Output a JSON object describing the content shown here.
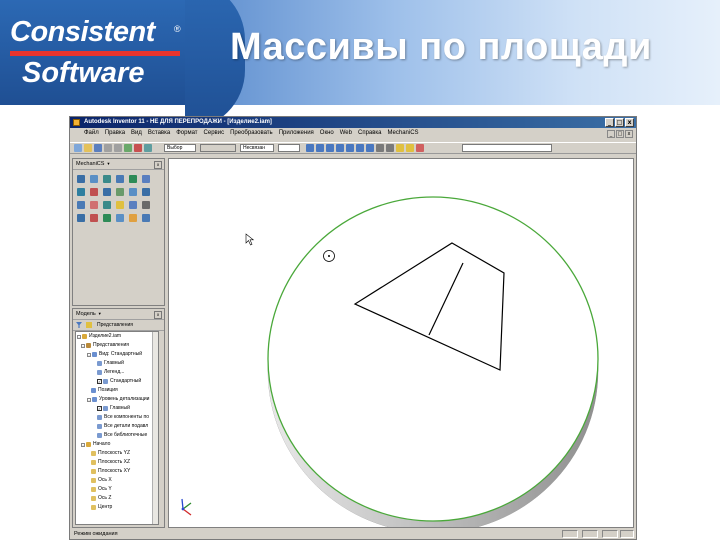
{
  "slide": {
    "title": "Массивы по площади",
    "logo": {
      "line1": "Consistent",
      "line2": "Software",
      "registered": "®"
    }
  },
  "window": {
    "title": "Autodesk Inventor 11 - НЕ ДЛЯ ПЕРЕПРОДАЖИ - [Изделие2.iam]",
    "controls": [
      "_",
      "□",
      "x"
    ]
  },
  "menu": {
    "items": [
      "Файл",
      "Правка",
      "Вид",
      "Вставка",
      "Формат",
      "Сервис",
      "Преобразовать",
      "Приложения",
      "Окно",
      "Web",
      "Справка",
      "MechaniCS"
    ],
    "mdi_controls": [
      "_",
      "□",
      "x"
    ]
  },
  "toolbar": {
    "select_label": "Выбор",
    "combo2": "",
    "combo3": "Несвязан",
    "combo4": "",
    "combo5": ""
  },
  "panel_top": {
    "title": "MechaniCS",
    "close": "x"
  },
  "panel_bottom": {
    "title": "Модель",
    "close": "x",
    "toolbar_label": "Представления",
    "tree": [
      {
        "label": "Изделие2.iam",
        "level": 0,
        "expander": "-"
      },
      {
        "label": "Представления",
        "level": 1,
        "expander": "-"
      },
      {
        "label": "Вид: Стандартный",
        "level": 2,
        "expander": "-"
      },
      {
        "label": "Главный",
        "level": 3
      },
      {
        "label": "Легенд...",
        "level": 3
      },
      {
        "label": "Стандартный",
        "level": 3,
        "checked": true
      },
      {
        "label": "Позиция",
        "level": 2
      },
      {
        "label": "Уровень детализации",
        "level": 2,
        "expander": "-"
      },
      {
        "label": "Главный",
        "level": 3,
        "checked": true
      },
      {
        "label": "Все компоненты по",
        "level": 3
      },
      {
        "label": "Все детали подавл",
        "level": 3
      },
      {
        "label": "Все библиотечные",
        "level": 3
      },
      {
        "label": "Начало",
        "level": 1,
        "expander": "-"
      },
      {
        "label": "Плоскость YZ",
        "level": 2
      },
      {
        "label": "Плоскость XZ",
        "level": 2
      },
      {
        "label": "Плоскость XY",
        "level": 2
      },
      {
        "label": "Ось X",
        "level": 2
      },
      {
        "label": "Ось Y",
        "level": 2
      },
      {
        "label": "Ось Z",
        "level": 2
      },
      {
        "label": "Центр",
        "level": 2
      }
    ]
  },
  "status": {
    "text": "Режим ожидания"
  },
  "colors": {
    "header_dark": "#1f4f93",
    "title_bar": "#0a246a",
    "part_edge": "#4aa83a",
    "sketch_line": "#000000",
    "logo_red": "#e8342d"
  }
}
